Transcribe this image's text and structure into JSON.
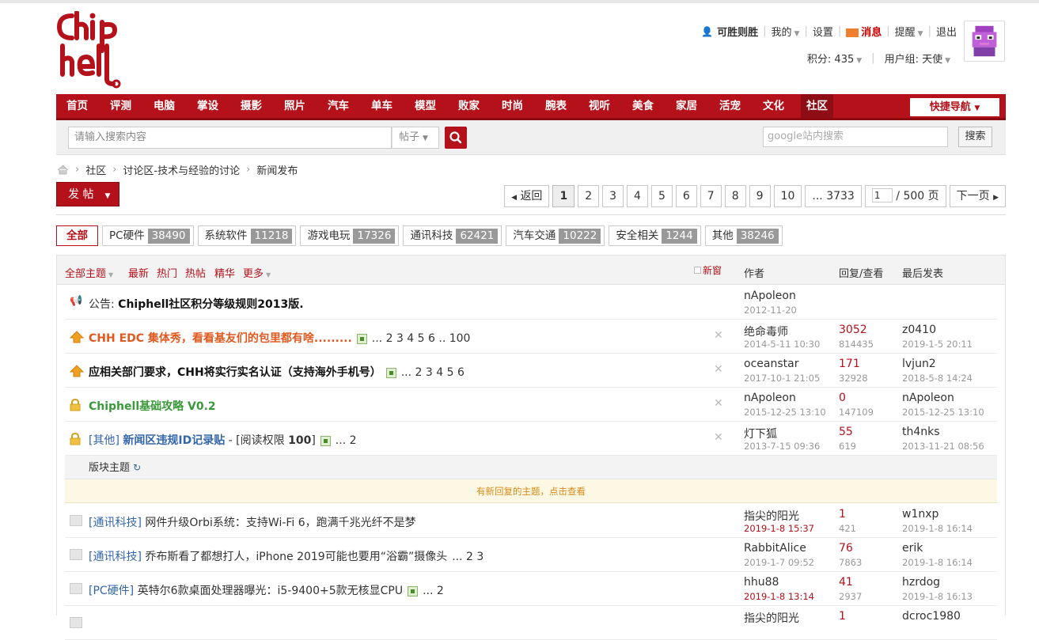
{
  "header": {
    "username": "可胜则胜",
    "my": "我的",
    "settings": "设置",
    "messages": "消息",
    "remind": "提醒",
    "logout": "退出",
    "points": "积分: 435",
    "usergroup": "用户组: 天使"
  },
  "nav": {
    "items": [
      "首页",
      "评测",
      "电脑",
      "掌设",
      "摄影",
      "照片",
      "汽车",
      "单车",
      "模型",
      "败家",
      "时尚",
      "腕表",
      "视听",
      "美食",
      "家居",
      "活宠",
      "文化",
      "社区"
    ],
    "quick": "快捷导航"
  },
  "search": {
    "placeholder": "请输入搜索内容",
    "type": "帖子",
    "google_placeholder": "google站内搜索",
    "google_button": "搜索"
  },
  "breadcrumb": [
    "社区",
    "讨论区-技术与经验的讨论",
    "新闻发布"
  ],
  "post_button": "发 帖",
  "pager": {
    "back": "返回",
    "pages": [
      "1",
      "2",
      "3",
      "4",
      "5",
      "6",
      "7",
      "8",
      "9",
      "10"
    ],
    "last": "... 3733",
    "input_value": "1",
    "total": "/ 500 页",
    "next": "下一页"
  },
  "categories": [
    {
      "label": "全部",
      "count": ""
    },
    {
      "label": "PC硬件",
      "count": "38490"
    },
    {
      "label": "系统软件",
      "count": "11218"
    },
    {
      "label": "游戏电玩",
      "count": "17326"
    },
    {
      "label": "通讯科技",
      "count": "62421"
    },
    {
      "label": "汽车交通",
      "count": "10222"
    },
    {
      "label": "安全相关",
      "count": "1244"
    },
    {
      "label": "其他",
      "count": "38246"
    }
  ],
  "table_head": {
    "all": "全部主题",
    "latest": "最新",
    "hot": "热门",
    "hotpost": "热帖",
    "digest": "精华",
    "more": "更多",
    "newwin": "新窗",
    "author": "作者",
    "replies": "回复/查看",
    "lastpost": "最后发表"
  },
  "pinned": [
    {
      "prefix": "公告:",
      "title": "Chiphell社区积分等级规则2013版.",
      "pages": "",
      "author": "nApoleon",
      "date": "2012-11-20",
      "replies": "",
      "views": "",
      "last_user": "",
      "last_date": ""
    },
    {
      "prefix": "",
      "title": "CHH EDC 集体秀，看看基友们的包里都有啥.........",
      "pages": "... 2 3 4 5 6 .. 100",
      "author": "绝命毒师",
      "date": "2014-5-11 10:30",
      "replies": "3052",
      "views": "814435",
      "last_user": "z0410",
      "last_date": "2019-1-5 20:11"
    },
    {
      "prefix": "",
      "title": "应相关部门要求，CHH将实行实名认证（支持海外手机号）",
      "pages": "... 2 3 4 5 6",
      "author": "oceanstar",
      "date": "2017-10-1 21:05",
      "replies": "171",
      "views": "32928",
      "last_user": "lvjun2",
      "last_date": "2018-5-8 14:24"
    },
    {
      "prefix": "",
      "title": "Chiphell基础攻略 V0.2",
      "pages": "",
      "author": "nApoleon",
      "date": "2015-12-25 13:10",
      "replies": "0",
      "views": "147109",
      "last_user": "nApoleon",
      "last_date": "2015-12-25 13:10"
    },
    {
      "prefix": "[其他]",
      "title": "新闻区违规ID记录贴",
      "suffix": "- [阅读权限",
      "perm": "100",
      "pages": "... 2",
      "author": "灯下狐",
      "date": "2013-7-15 09:36",
      "replies": "55",
      "views": "619",
      "last_user": "th4nks",
      "last_date": "2013-11-21 08:56"
    }
  ],
  "section_label": "版块主题",
  "notice": "有新回复的主题，点击查看",
  "threads": [
    {
      "tag": "[通讯科技]",
      "title": "网件升级Orbi系统：支持Wi-Fi 6，跑满千兆光纤不是梦",
      "pages": "",
      "author": "指尖的阳光",
      "date": "2019-1-8 15:37",
      "replies": "1",
      "views": "421",
      "last_user": "w1nxp",
      "last_date": "2019-1-8 16:14"
    },
    {
      "tag": "[通讯科技]",
      "title": "乔布斯看了都想打人，iPhone 2019可能也要用“浴霸”摄像头",
      "pages": "... 2 3",
      "author": "RabbitAlice",
      "date": "2019-1-7 09:52",
      "replies": "76",
      "views": "7863",
      "last_user": "erik",
      "last_date": "2019-1-8 16:14"
    },
    {
      "tag": "[PC硬件]",
      "title": "英特尔6款桌面处理器曝光：i5-9400+5款无核显CPU",
      "pages": "... 2",
      "author": "hhu88",
      "date": "2019-1-8 13:14",
      "replies": "41",
      "views": "2937",
      "last_user": "hzrdog",
      "last_date": "2019-1-8 16:13"
    },
    {
      "tag": "",
      "title": "",
      "pages": "",
      "author": "指尖的阳光",
      "date": "",
      "replies": "1",
      "views": "",
      "last_user": "dcroc1980",
      "last_date": ""
    }
  ],
  "colors": {
    "brand": "#b4111a",
    "tag": "#3366aa",
    "green": "#3a9a3a",
    "orange": "#e05a20"
  }
}
